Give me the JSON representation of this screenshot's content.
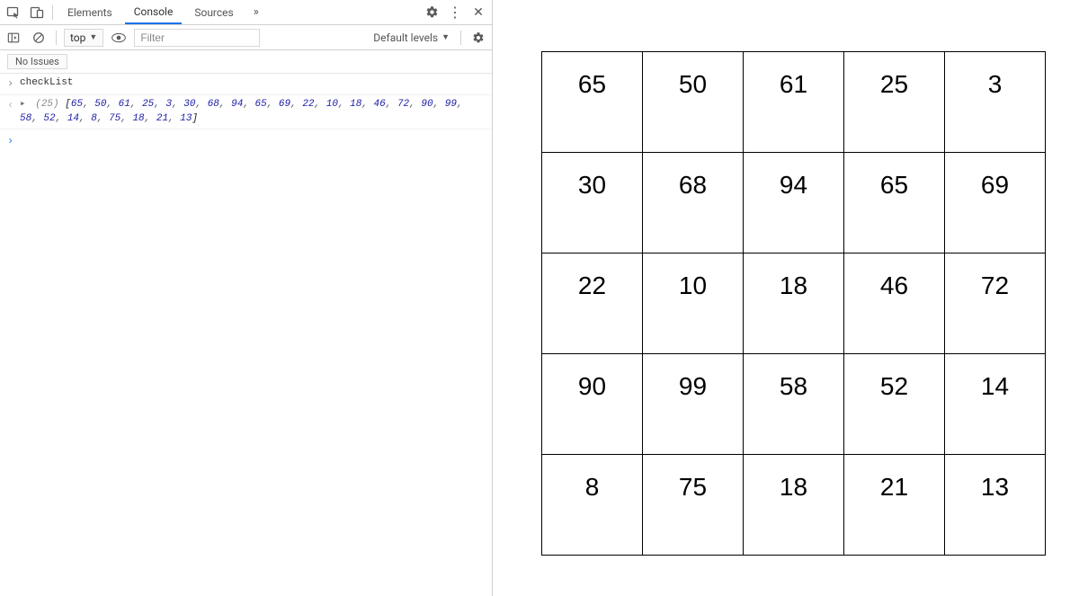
{
  "tabs": {
    "elements": "Elements",
    "console": "Console",
    "sources": "Sources"
  },
  "filter": {
    "context": "top",
    "placeholder": "Filter",
    "levels": "Default levels"
  },
  "issues": {
    "label": "No Issues"
  },
  "console": {
    "call": "checkList",
    "array_len": "(25)",
    "items": [
      "65",
      "50",
      "61",
      "25",
      "3",
      "30",
      "68",
      "94",
      "65",
      "69",
      "22",
      "10",
      "18",
      "46",
      "72",
      "90",
      "99",
      "58",
      "52",
      "14",
      "8",
      "75",
      "18",
      "21",
      "13"
    ]
  },
  "grid": [
    [
      65,
      50,
      61,
      25,
      3
    ],
    [
      30,
      68,
      94,
      65,
      69
    ],
    [
      22,
      10,
      18,
      46,
      72
    ],
    [
      90,
      99,
      58,
      52,
      14
    ],
    [
      8,
      75,
      18,
      21,
      13
    ]
  ]
}
